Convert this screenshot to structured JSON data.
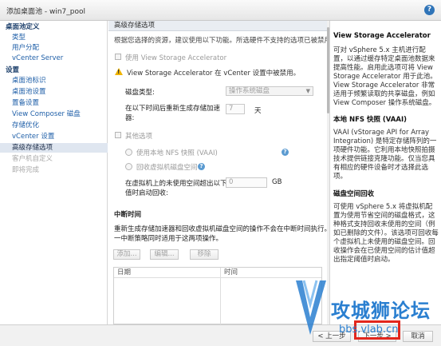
{
  "window": {
    "title": "添加桌面池 - win7_pool",
    "help_label": "?"
  },
  "nav": {
    "items": [
      {
        "label": "桌面池定义",
        "kind": "head"
      },
      {
        "label": "类型",
        "kind": "sub"
      },
      {
        "label": "用户分配",
        "kind": "sub"
      },
      {
        "label": "vCenter Server",
        "kind": "sub"
      },
      {
        "label": "设置",
        "kind": "head"
      },
      {
        "label": "桌面池标识",
        "kind": "sub"
      },
      {
        "label": "桌面池设置",
        "kind": "sub"
      },
      {
        "label": "置备设置",
        "kind": "sub"
      },
      {
        "label": "View Composer 磁盘",
        "kind": "sub"
      },
      {
        "label": "存储优化",
        "kind": "sub"
      },
      {
        "label": "vCenter 设置",
        "kind": "sub"
      },
      {
        "label": "高级存储选项",
        "kind": "selected"
      },
      {
        "label": "客户机自定义",
        "kind": "disabled"
      },
      {
        "label": "即将完成",
        "kind": "disabled"
      }
    ]
  },
  "main": {
    "section_title": "高级存储选项",
    "intro": "根据您选择的资源，建议使用以下功能。所选硬件不支持的选项已被禁用。",
    "use_accelerator_label": "使用 View Storage Accelerator",
    "warning_text": "View Storage Accelerator 在 vCenter 设置中被禁用。",
    "disk_type_label": "磁盘类型:",
    "disk_type_value": "操作系统磁盘",
    "regen_label_1": "在以下时间后重新生成存储加速",
    "regen_label_2": "器:",
    "regen_value": "7",
    "regen_unit": "天",
    "other_options_label": "其他选项",
    "use_vaai_label": "使用本地 NFS 快照 (VAAI)",
    "reclaim_label": "回收虚拟机磁盘空间",
    "reclaim_threshold_label_1": "在虚拟机上的未使用空间超出以下",
    "reclaim_threshold_label_2": "值时启动回收:",
    "reclaim_threshold_value": "0",
    "reclaim_threshold_unit": "GB",
    "blackout_title": "中断时间",
    "blackout_desc_1": "重新生成存储加速器和回收虚拟机磁盘空间的操作不会在中断时间执行。同",
    "blackout_desc_2": "一中断策略同时适用于这两项操作。",
    "add_button": "添加...",
    "edit_button": "编辑...",
    "remove_button": "移除",
    "table_columns": [
      "日期",
      "时间"
    ]
  },
  "help": {
    "heading1": "View Storage Accelerator",
    "para1": "可对 vSphere 5.x 主机进行配置，以通过缓存特定桌面池数据来提高性能。启用此选项可将 View Storage Accelerator 用于此池。View Storage Accelerator 非常适用于频繁读取的共享磁盘，例如 View Composer 操作系统磁盘。",
    "heading2": "本地 NFS 快照 (VAAI)",
    "para2": "VAAI (vStorage API for Array Integration) 是特定存储阵列的一项硬件功能。它利用本地快照拍摄技术提供链接克隆功能。仅当您具有相应的硬件设备时才选择此选项。",
    "heading3": "磁盘空间回收",
    "para3": "可使用 vSphere 5.x 将虚拟机配置为使用节省空间的磁盘格式，这种格式支持回收未使用的空间（例如已删除的文件）。该选项可回收每个虚拟机上未使用的磁盘空间。回收操作会在已使用空间的估计值超出指定阈值时启动。"
  },
  "footer": {
    "back_button": "< 上一步",
    "next_button": "下一步 >",
    "cancel_button": "取消"
  },
  "watermark": {
    "text1": "攻城狮论坛",
    "text2": "bbs.vlab.cn",
    "color": "#2a7fd0"
  }
}
